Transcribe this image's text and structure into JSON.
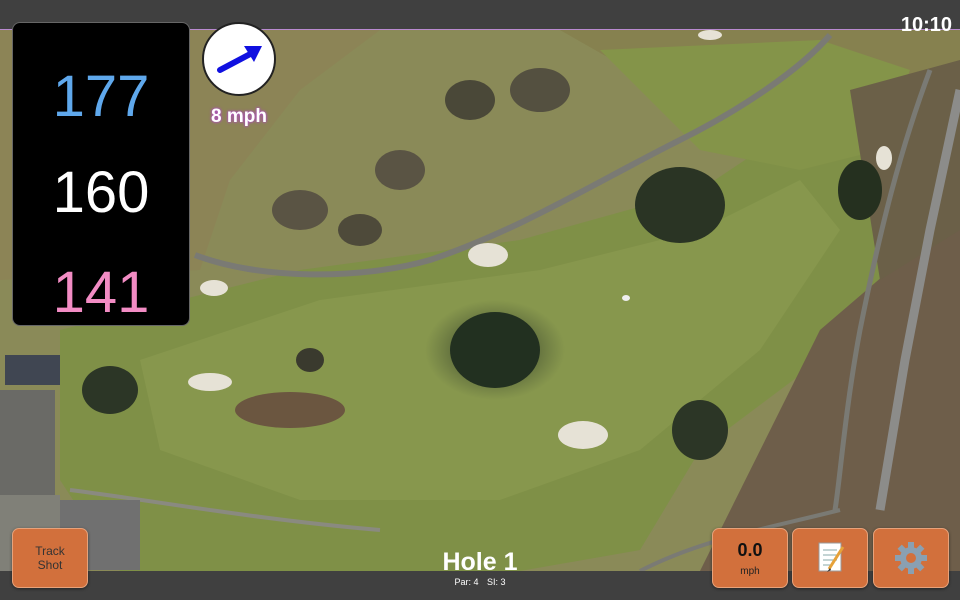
{
  "status_bar": {
    "time": "10:10"
  },
  "distances": {
    "back": "177",
    "middle": "160",
    "front": "141"
  },
  "wind": {
    "speed_label": "8 mph",
    "icon": "arrow-icon"
  },
  "buttons": {
    "track_shot": [
      "Track",
      "Shot"
    ],
    "speed": {
      "value": "0.0",
      "unit": "mph"
    },
    "notes_icon": "notepad-icon",
    "settings_icon": "gear-icon"
  },
  "hole": {
    "title": "Hole 1",
    "par": "Par: 4",
    "si": "SI: 3"
  },
  "colors": {
    "back": "#5fa8ec",
    "middle": "#ffffff",
    "front": "#f28cc4",
    "button": "#d2703c",
    "wind_label_glow": "#b24bc8"
  }
}
